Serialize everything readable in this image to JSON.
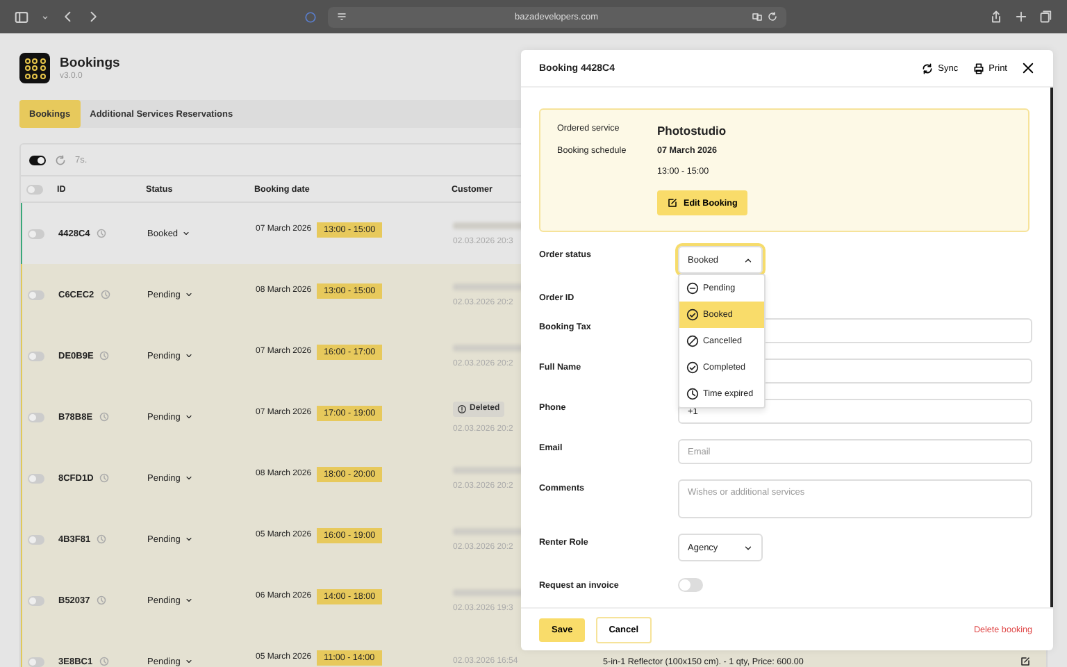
{
  "browser": {
    "url": "bazadevelopers.com"
  },
  "app": {
    "title": "Bookings",
    "version": "v3.0.0"
  },
  "tabs": [
    {
      "label": "Bookings",
      "selected": true
    },
    {
      "label": "Additional Services Reservations",
      "selected": false
    }
  ],
  "toolbar": {
    "on": true,
    "interval": "7s."
  },
  "table": {
    "select_all": {
      "checked": false
    },
    "columns": [
      "ID",
      "Status",
      "Booking date",
      "Customer"
    ],
    "rows": [
      {
        "id": "4428C4",
        "status": "Booked",
        "date": "07 March 2026",
        "time": "13:00 - 15:00",
        "created": "02.03.2026 20:3",
        "selected": true,
        "checked": false
      },
      {
        "id": "C6CEC2",
        "status": "Pending",
        "date": "08 March 2026",
        "time": "13:00 - 15:00",
        "created": "02.03.2026 20:2",
        "selected": false,
        "checked": false
      },
      {
        "id": "DE0B9E",
        "status": "Pending",
        "date": "07 March 2026",
        "time": "16:00 - 17:00",
        "created": "02.03.2026 20:2",
        "selected": false,
        "checked": false
      },
      {
        "id": "B78B8E",
        "status": "Pending",
        "date": "07 March 2026",
        "time": "17:00 - 19:00",
        "created": "02.03.2026 20:2",
        "selected": false,
        "checked": false,
        "badge": "Deleted"
      },
      {
        "id": "8CFD1D",
        "status": "Pending",
        "date": "08 March 2026",
        "time": "18:00 - 20:00",
        "created": "02.03.2026 20:2",
        "selected": false,
        "checked": false
      },
      {
        "id": "4B3F81",
        "status": "Pending",
        "date": "05 March 2026",
        "time": "16:00 - 19:00",
        "created": "02.03.2026 20:2",
        "selected": false,
        "checked": false
      },
      {
        "id": "B52037",
        "status": "Pending",
        "date": "06 March 2026",
        "time": "14:00 - 18:00",
        "created": "02.03.2026 19:3",
        "selected": false,
        "checked": false
      },
      {
        "id": "3E8BC1",
        "status": "Pending",
        "date": "05 March 2026",
        "time": "11:00 - 14:00",
        "created": "02.03.2026 16:54",
        "selected": false,
        "checked": false,
        "note": "5-in-1 Reflector (100x150 cm). - 1 qty, Price: 600.00"
      }
    ]
  },
  "modal": {
    "title": "Booking 4428C4",
    "actions": [
      "Sync",
      "Print"
    ],
    "summary": {
      "service_label": "Ordered service",
      "service": "Photostudio",
      "schedule_label": "Booking schedule",
      "date": "07 March 2026",
      "time": "13:00 - 15:00",
      "edit_button": "Edit Booking"
    },
    "fields": [
      {
        "kind": "select",
        "label": "Order status",
        "value": "Booked",
        "expanded": true,
        "options": [
          {
            "label": "Pending",
            "kind": "pending",
            "selected": false
          },
          {
            "label": "Booked",
            "kind": "booked",
            "selected": true
          },
          {
            "label": "Cancelled",
            "kind": "cancelled",
            "selected": false
          },
          {
            "label": "Completed",
            "kind": "completed",
            "selected": false
          },
          {
            "label": "Time expired",
            "kind": "expired",
            "selected": false
          }
        ]
      },
      {
        "kind": "plain",
        "label": "Order ID"
      },
      {
        "kind": "text",
        "label": "Booking Tax"
      },
      {
        "kind": "text",
        "label": "Full Name"
      },
      {
        "kind": "text",
        "label": "Phone",
        "value": "+1"
      },
      {
        "kind": "text",
        "label": "Email",
        "placeholder": "Email"
      },
      {
        "kind": "textarea",
        "label": "Comments",
        "placeholder": "Wishes or additional services"
      },
      {
        "kind": "select",
        "label": "Renter Role",
        "value": "Agency",
        "expanded": false
      },
      {
        "kind": "toggle",
        "label": "Request an invoice",
        "on": false
      }
    ],
    "footer": {
      "save": "Save",
      "cancel": "Cancel",
      "delete": "Delete booking"
    }
  }
}
